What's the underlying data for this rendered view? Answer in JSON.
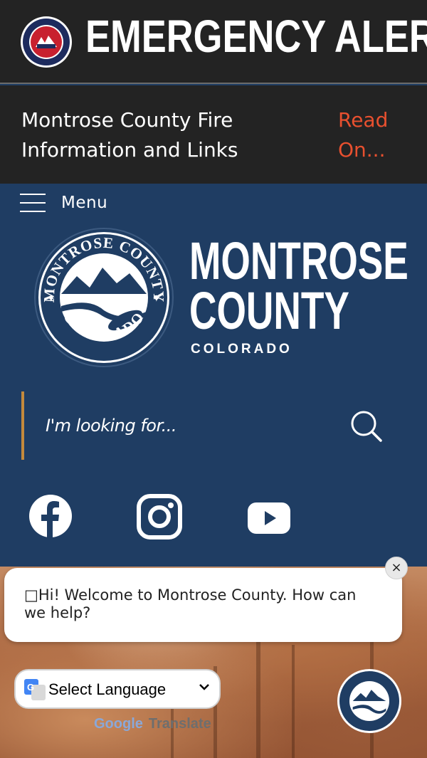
{
  "alert": {
    "title": "EMERGENCY ALERTS",
    "notice_text": "Montrose County Fire Information and Links",
    "read_on": "Read On..."
  },
  "header": {
    "menu_label": "Menu",
    "county_name_line1": "MONTROSE",
    "county_name_line2": "COUNTY",
    "county_state": "COLORADO",
    "seal_text_top": "MONTROSE COUNTY",
    "seal_text_bottom": "COLORADO",
    "search_placeholder": "I'm looking for...",
    "social": [
      "facebook-icon",
      "instagram-icon",
      "youtube-icon"
    ]
  },
  "chat": {
    "message": "□Hi! Welcome to Montrose County. How can we help?",
    "close_label": "×"
  },
  "translate": {
    "select_label": "Select Language",
    "powered_google": "Google",
    "powered_translate": "Translate"
  },
  "colors": {
    "header_bg": "#1f3d63",
    "alert_bg": "#232323",
    "link_orange": "#e8502f",
    "search_accent": "#c48a3c"
  }
}
